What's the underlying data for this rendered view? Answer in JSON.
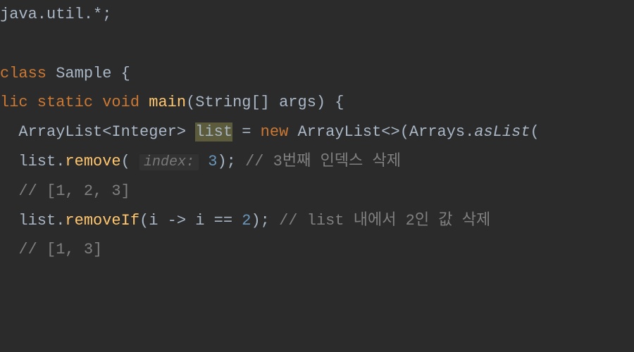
{
  "code": {
    "line1": {
      "pkg": "java.util.*",
      "semi": ";"
    },
    "line3": {
      "kw_class": "class",
      "name": "Sample",
      "brace": " {"
    },
    "line4": {
      "kw_mods": "lic static void",
      "method": " main",
      "params": "(String[] args) {"
    },
    "line5": {
      "indent": "  ",
      "type1": "ArrayList<Integer> ",
      "var_hl": "list",
      "eq": " = ",
      "kw_new": "new",
      "ctor": " ArrayList<>(Arrays.",
      "static_m": "asList",
      "tail": "("
    },
    "line6": {
      "indent": "  ",
      "obj": "list.",
      "method": "remove",
      "open": "( ",
      "hint": "index:",
      "arg": " 3",
      "close": ");",
      "comment": " // 3번째 인덱스 삭제"
    },
    "line7": {
      "indent": "  ",
      "comment": "// [1, 2, 3]"
    },
    "line8": {
      "indent": "  ",
      "obj": "list.",
      "method": "removeIf",
      "open": "(i -> i == ",
      "num": "2",
      "close": ");",
      "comment": " // list 내에서 2인 값 삭제"
    },
    "line9": {
      "indent": "  ",
      "comment": "// [1, 3]"
    }
  }
}
